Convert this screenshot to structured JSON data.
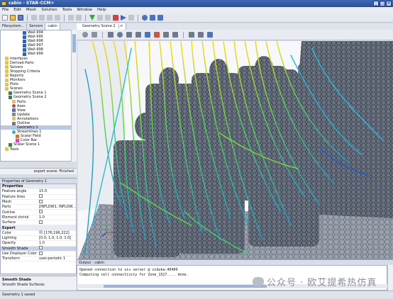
{
  "window": {
    "title": "cabin - STAR-CCM+"
  },
  "menu": [
    "File",
    "Edit",
    "Mesh",
    "Solution",
    "Tools",
    "Window",
    "Help"
  ],
  "left_tabs": [
    "Filesystem...",
    "Servers",
    "cabin"
  ],
  "tree": [
    {
      "label": "Wall-994",
      "indent": 6,
      "icon": "boundary"
    },
    {
      "label": "Wall-995",
      "indent": 6,
      "icon": "boundary"
    },
    {
      "label": "Wall-996",
      "indent": 6,
      "icon": "boundary"
    },
    {
      "label": "Wall-997",
      "indent": 6,
      "icon": "boundary"
    },
    {
      "label": "Wall-998",
      "indent": 6,
      "icon": "boundary"
    },
    {
      "label": "Wall-999",
      "indent": 6,
      "icon": "boundary"
    },
    {
      "label": "Interfaces",
      "indent": 1,
      "icon": "folder"
    },
    {
      "label": "Derived Parts",
      "indent": 1,
      "icon": "folder"
    },
    {
      "label": "Solvers",
      "indent": 1,
      "icon": "folder"
    },
    {
      "label": "Stopping Criteria",
      "indent": 1,
      "icon": "folder"
    },
    {
      "label": "Reports",
      "indent": 1,
      "icon": "folder"
    },
    {
      "label": "Monitors",
      "indent": 1,
      "icon": "folder"
    },
    {
      "label": "Plots",
      "indent": 1,
      "icon": "folder"
    },
    {
      "label": "Scenes",
      "indent": 1,
      "icon": "folder"
    },
    {
      "label": "Geometry Scene 1",
      "indent": 2,
      "icon": "scene"
    },
    {
      "label": "Geometry Scene 2",
      "indent": 2,
      "icon": "scene"
    },
    {
      "label": "Parts",
      "indent": 3,
      "icon": "folder"
    },
    {
      "label": "Axes",
      "indent": 3,
      "icon": "axes"
    },
    {
      "label": "View",
      "indent": 3,
      "icon": "view"
    },
    {
      "label": "Update",
      "indent": 3,
      "icon": "update"
    },
    {
      "label": "Annotations",
      "indent": 3,
      "icon": "folder"
    },
    {
      "label": "Outline",
      "indent": 3,
      "icon": "outline"
    },
    {
      "label": "Geometry 1",
      "indent": 3,
      "icon": "geometry",
      "selected": true
    },
    {
      "label": "Streamlines 1",
      "indent": 3,
      "icon": "stream"
    },
    {
      "label": "Scalar Field",
      "indent": 4,
      "icon": "field"
    },
    {
      "label": "Color Bar",
      "indent": 4,
      "icon": "colorbar"
    },
    {
      "label": "Scalar Scene 1",
      "indent": 2,
      "icon": "scene"
    },
    {
      "label": "Tools",
      "indent": 1,
      "icon": "folder"
    }
  ],
  "status_left": "export scene: Finished",
  "properties": {
    "header": "Properties of Geometry 1",
    "rows": [
      {
        "type": "section",
        "key": "Properties"
      },
      {
        "key": "Feature angle",
        "value": "15.0"
      },
      {
        "key": "Feature lines",
        "value": "",
        "check": true
      },
      {
        "key": "Mesh",
        "value": "",
        "check": true
      },
      {
        "key": "Parts",
        "value": "[INFLOW1, INFLOW..."
      },
      {
        "key": "Outline",
        "value": "",
        "check": true
      },
      {
        "key": "Element shrink",
        "value": "1.0"
      },
      {
        "key": "Surface",
        "value": "",
        "check": true
      },
      {
        "type": "section",
        "key": "Expert"
      },
      {
        "key": "Color",
        "value": "[176,196,222]",
        "swatch": "#b0c4de"
      },
      {
        "key": "Lighting",
        "value": "[0.0, 1.0, 1.0, 1.0]"
      },
      {
        "key": "Opacity",
        "value": "1.0"
      },
      {
        "key": "Smooth Shade",
        "value": "",
        "check": true,
        "selected": true
      },
      {
        "key": "Use Displayer Color",
        "value": "",
        "check": true
      },
      {
        "key": "Transform",
        "value": "user-periodic 1"
      }
    ]
  },
  "smooth_help": {
    "title": "Smooth Shade",
    "text": "Smooth Shade Surfaces"
  },
  "scene_tab": "Geometry Scene 2",
  "output": {
    "header": "Output - cabin",
    "lines": [
      "Opened connection to vis server @ viduka:40489",
      "Computing cell connectivity for Zone_1527.... done."
    ]
  },
  "status_bottom": "Geometry 1 saved",
  "watermark": "公众号 · 欧艾提希热仿真",
  "colors": {
    "accent": "#2d55a0",
    "streamline_hot": "#ffd000",
    "streamline_mid": "#3dd14a",
    "streamline_cold": "#1aa6d4",
    "mesh": "#3c4149"
  }
}
